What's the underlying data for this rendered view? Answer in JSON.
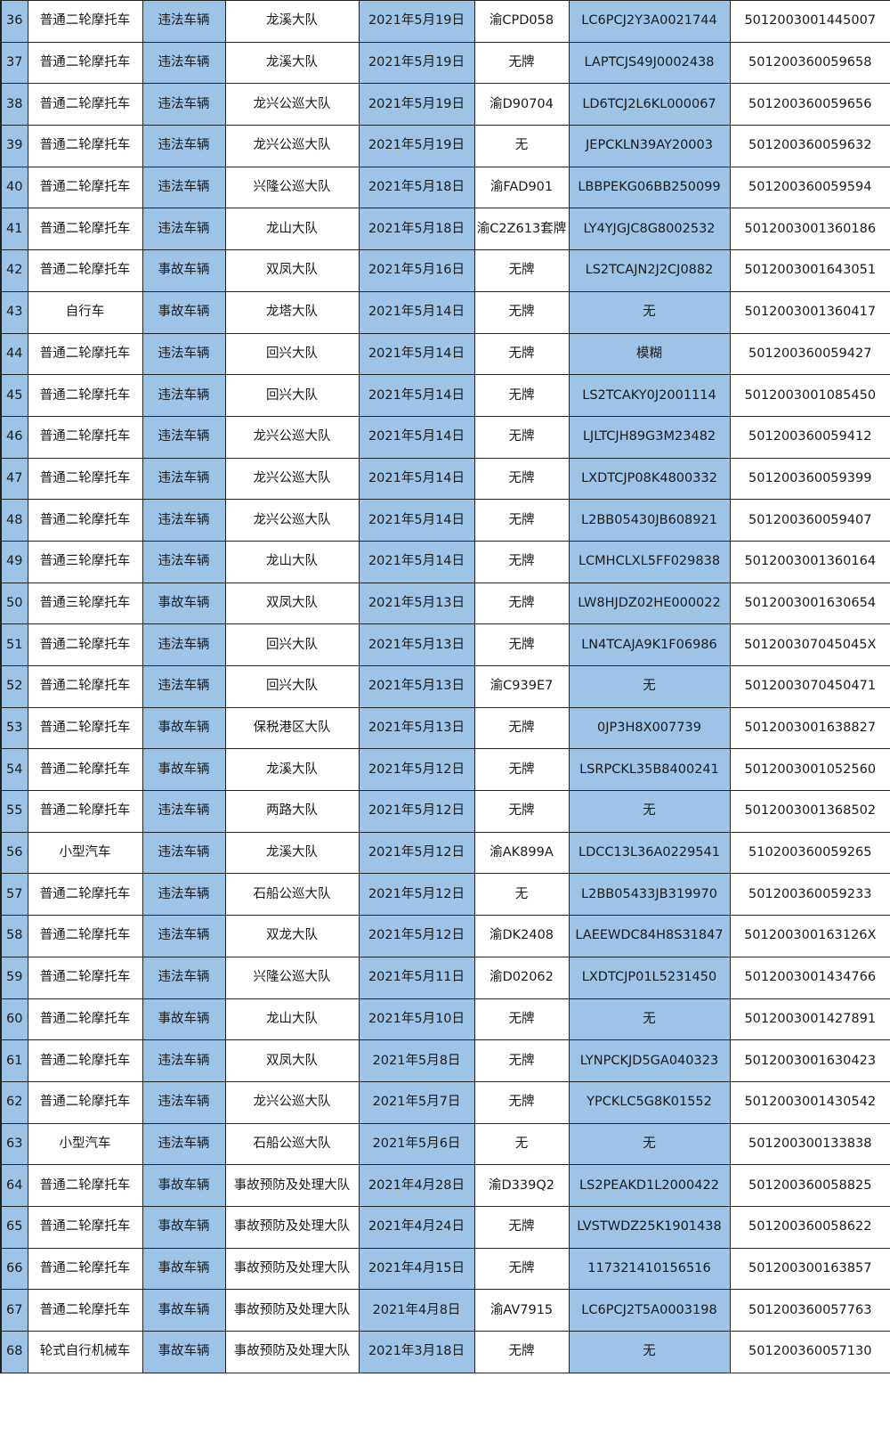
{
  "colors": {
    "blue_column": "#9dc3e6",
    "white_column": "#ffffff",
    "grid": "#222222"
  },
  "rows": [
    {
      "no": "36",
      "type": "普通二轮摩托车",
      "category": "违法车辆",
      "unit": "龙溪大队",
      "date": "2021年5月19日",
      "plate": "渝CPD058",
      "vin": "LC6PCJ2Y3A0021744",
      "code": "501200300144500​7"
    },
    {
      "no": "37",
      "type": "普通二轮摩托车",
      "category": "违法车辆",
      "unit": "龙溪大队",
      "date": "2021年5月19日",
      "plate": "无牌",
      "vin": "LAPTCJS49J0002438",
      "code": "501200360059658"
    },
    {
      "no": "38",
      "type": "普通二轮摩托车",
      "category": "违法车辆",
      "unit": "龙兴公巡大队",
      "date": "2021年5月19日",
      "plate": "渝D90704",
      "vin": "LD6TCJ2L6KL000067",
      "code": "501200360059656"
    },
    {
      "no": "39",
      "type": "普通二轮摩托车",
      "category": "违法车辆",
      "unit": "龙兴公巡大队",
      "date": "2021年5月19日",
      "plate": "无",
      "vin": "JEPCKLN39AY20003",
      "code": "501200360059632"
    },
    {
      "no": "40",
      "type": "普通二轮摩托车",
      "category": "违法车辆",
      "unit": "兴隆公巡大队",
      "date": "2021年5月18日",
      "plate": "渝FAD901",
      "vin": "LBBPEKG06BB250099",
      "code": "501200360059594"
    },
    {
      "no": "41",
      "type": "普通二轮摩托车",
      "category": "违法车辆",
      "unit": "龙山大队",
      "date": "2021年5月18日",
      "plate": "渝C2Z613套牌",
      "vin": "LY4YJGJC8G8002532",
      "code": "5012003001360186"
    },
    {
      "no": "42",
      "type": "普通二轮摩托车",
      "category": "事故车辆",
      "unit": "双凤大队",
      "date": "2021年5月16日",
      "plate": "无牌",
      "vin": "LS2TCAJN2J2CJ0882",
      "code": "5012003001643051"
    },
    {
      "no": "43",
      "type": "自行车",
      "category": "事故车辆",
      "unit": "龙塔大队",
      "date": "2021年5月14日",
      "plate": "无牌",
      "vin": "无",
      "code": "5012003001360417"
    },
    {
      "no": "44",
      "type": "普通二轮摩托车",
      "category": "违法车辆",
      "unit": "回兴大队",
      "date": "2021年5月14日",
      "plate": "无牌",
      "vin": "模糊",
      "code": "501200360059427"
    },
    {
      "no": "45",
      "type": "普通二轮摩托车",
      "category": "违法车辆",
      "unit": "回兴大队",
      "date": "2021年5月14日",
      "plate": "无牌",
      "vin": "LS2TCAKY0J2001114",
      "code": "5012003001085450"
    },
    {
      "no": "46",
      "type": "普通二轮摩托车",
      "category": "违法车辆",
      "unit": "龙兴公巡大队",
      "date": "2021年5月14日",
      "plate": "无牌",
      "vin": "LJLTCJH89G3M23482",
      "code": "501200360059412"
    },
    {
      "no": "47",
      "type": "普通二轮摩托车",
      "category": "违法车辆",
      "unit": "龙兴公巡大队",
      "date": "2021年5月14日",
      "plate": "无牌",
      "vin": "LXDTCJP08K4800332",
      "code": "501200360059399"
    },
    {
      "no": "48",
      "type": "普通二轮摩托车",
      "category": "违法车辆",
      "unit": "龙兴公巡大队",
      "date": "2021年5月14日",
      "plate": "无牌",
      "vin": "L2BB05430JB608921",
      "code": "501200360059407"
    },
    {
      "no": "49",
      "type": "普通三轮摩托车",
      "category": "违法车辆",
      "unit": "龙山大队",
      "date": "2021年5月14日",
      "plate": "无牌",
      "vin": "LCMHCLXL5FF029838",
      "code": "5012003001360164"
    },
    {
      "no": "50",
      "type": "普通三轮摩托车",
      "category": "事故车辆",
      "unit": "双凤大队",
      "date": "2021年5月13日",
      "plate": "无牌",
      "vin": "LW8HJDZ02HE000022",
      "code": "5012003001630654"
    },
    {
      "no": "51",
      "type": "普通二轮摩托车",
      "category": "违法车辆",
      "unit": "回兴大队",
      "date": "2021年5月13日",
      "plate": "无牌",
      "vin": "LN4TCAJA9K1F06986",
      "code": "501200307045045X"
    },
    {
      "no": "52",
      "type": "普通二轮摩托车",
      "category": "违法车辆",
      "unit": "回兴大队",
      "date": "2021年5月13日",
      "plate": "渝C939E7",
      "vin": "无",
      "code": "501200307045047​1"
    },
    {
      "no": "53",
      "type": "普通二轮摩托车",
      "category": "事故车辆",
      "unit": "保税港区大队",
      "date": "2021年5月13日",
      "plate": "无牌",
      "vin": "0JP3H8X007739",
      "code": "5012003001638827"
    },
    {
      "no": "54",
      "type": "普通二轮摩托车",
      "category": "事故车辆",
      "unit": "龙溪大队",
      "date": "2021年5月12日",
      "plate": "无牌",
      "vin": "LSRPCKL35B8400241",
      "code": "5012003001052560"
    },
    {
      "no": "55",
      "type": "普通二轮摩托车",
      "category": "违法车辆",
      "unit": "两路大队",
      "date": "2021年5月12日",
      "plate": "无牌",
      "vin": "无",
      "code": "5012003001368502"
    },
    {
      "no": "56",
      "type": "小型汽车",
      "category": "违法车辆",
      "unit": "龙溪大队",
      "date": "2021年5月12日",
      "plate": "渝AK899A",
      "vin": "LDCC13L36A0229541",
      "code": "510200360059265"
    },
    {
      "no": "57",
      "type": "普通二轮摩托车",
      "category": "违法车辆",
      "unit": "石船公巡大队",
      "date": "2021年5月12日",
      "plate": "无",
      "vin": "L2BB05433JB319970",
      "code": "501200360059233"
    },
    {
      "no": "58",
      "type": "普通二轮摩托车",
      "category": "违法车辆",
      "unit": "双龙大队",
      "date": "2021年5月12日",
      "plate": "渝DK2408",
      "vin": "LAEEWDC84H8S31847",
      "code": "501200300163126X"
    },
    {
      "no": "59",
      "type": "普通二轮摩托车",
      "category": "违法车辆",
      "unit": "兴隆公巡大队",
      "date": "2021年5月11日",
      "plate": "渝D02062",
      "vin": "LXDTCJP01L5231450",
      "code": "5012003001434766"
    },
    {
      "no": "60",
      "type": "普通二轮摩托车",
      "category": "事故车辆",
      "unit": "龙山大队",
      "date": "2021年5月10日",
      "plate": "无牌",
      "vin": "无",
      "code": "5012003001427891"
    },
    {
      "no": "61",
      "type": "普通二轮摩托车",
      "category": "违法车辆",
      "unit": "双凤大队",
      "date": "2021年5月8日",
      "plate": "无牌",
      "vin": "LYNPCKJD5GA040323",
      "code": "5012003001630423"
    },
    {
      "no": "62",
      "type": "普通二轮摩托车",
      "category": "违法车辆",
      "unit": "龙兴公巡大队",
      "date": "2021年5月7日",
      "plate": "无牌",
      "vin": "YPCKLC5G8K01552",
      "code": "5012003001430542"
    },
    {
      "no": "63",
      "type": "小型汽车",
      "category": "违法车辆",
      "unit": "石船公巡大队",
      "date": "2021年5月6日",
      "plate": "无",
      "vin": "无",
      "code": "501200300133838"
    },
    {
      "no": "64",
      "type": "普通二轮摩托车",
      "category": "事故车辆",
      "unit": "事故预防及处理大队",
      "date": "2021年4月28日",
      "plate": "渝D339Q2",
      "vin": "LS2PEAKD1L2000422",
      "code": "501200360058825"
    },
    {
      "no": "65",
      "type": "普通二轮摩托车",
      "category": "事故车辆",
      "unit": "事故预防及处理大队",
      "date": "2021年4月24日",
      "plate": "无牌",
      "vin": "LVSTWDZ25K1901438",
      "code": "501200360058622"
    },
    {
      "no": "66",
      "type": "普通二轮摩托车",
      "category": "事故车辆",
      "unit": "事故预防及处理大队",
      "date": "2021年4月15日",
      "plate": "无牌",
      "vin": "117321410156516",
      "code": "501200300163857"
    },
    {
      "no": "67",
      "type": "普通二轮摩托车",
      "category": "事故车辆",
      "unit": "事故预防及处理大队",
      "date": "2021年4月8日",
      "plate": "渝AV7915",
      "vin": "LC6PCJ2T5A0003198",
      "code": "501200360057763"
    },
    {
      "no": "68",
      "type": "轮式自行机械车",
      "category": "事故车辆",
      "unit": "事故预防及处理大队",
      "date": "2021年3月18日",
      "plate": "无牌",
      "vin": "无",
      "code": "501200360057130"
    }
  ]
}
